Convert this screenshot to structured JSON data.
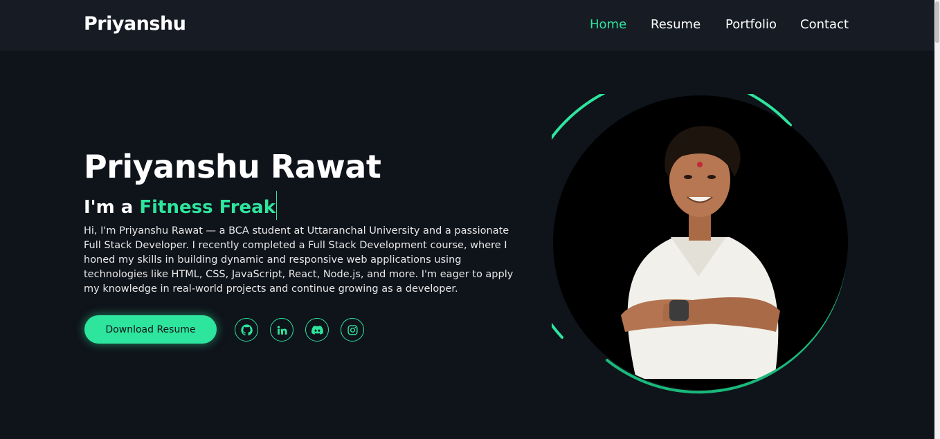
{
  "brand": "Priyanshu",
  "nav": {
    "home": "Home",
    "resume": "Resume",
    "portfolio": "Portfolio",
    "contact": "Contact"
  },
  "hero": {
    "name": "Priyanshu Rawat",
    "subtitle_prefix": "I'm a ",
    "subtitle_accent": "Fitness Freak",
    "bio": "Hi, I'm Priyanshu Rawat — a BCA student at Uttaranchal University and a passionate Full Stack Developer. I recently completed a Full Stack Development course, where I honed my skills in building dynamic and responsive web applications using technologies like HTML, CSS, JavaScript, React, Node.js, and more. I'm eager to apply my knowledge in real-world projects and continue growing as a developer.",
    "download_label": "Download Resume"
  },
  "social": [
    {
      "icon": "github-icon"
    },
    {
      "icon": "linkedin-icon"
    },
    {
      "icon": "discord-icon"
    },
    {
      "icon": "instagram-icon"
    }
  ],
  "colors": {
    "accent": "#2ee59d",
    "background": "#0f131a",
    "navbar": "#171c24"
  }
}
